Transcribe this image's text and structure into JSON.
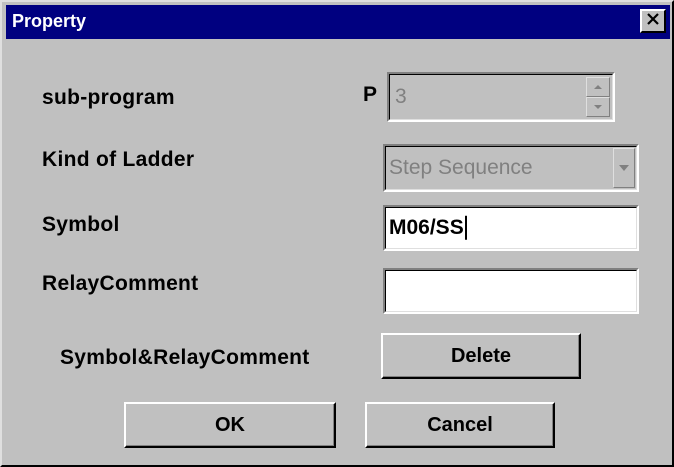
{
  "window": {
    "title": "Property",
    "close_icon": "close-icon"
  },
  "form": {
    "subprogram_label": "sub-program",
    "p_label": "P",
    "p_value": "3",
    "kind_label": "Kind of Ladder",
    "kind_value": "Step Sequence",
    "symbol_label": "Symbol",
    "symbol_value": "M06/SS",
    "relay_comment_label": "RelayComment",
    "relay_comment_value": "",
    "symbol_relay_label": "Symbol&RelayComment"
  },
  "buttons": {
    "delete": "Delete",
    "ok": "OK",
    "cancel": "Cancel"
  },
  "colors": {
    "titlebar": "#000080",
    "face": "#c0c0c0",
    "disabled_text": "#808080"
  }
}
